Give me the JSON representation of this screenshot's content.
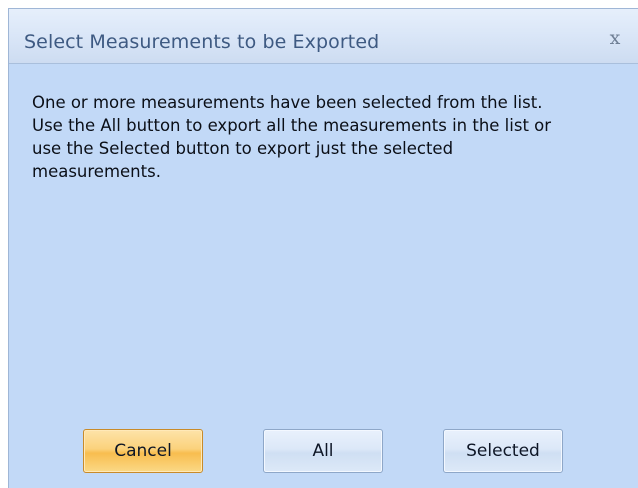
{
  "dialog": {
    "title": "Select Measurements to be Exported",
    "close_icon": "close-icon",
    "message_lines": [
      "One or more measurements have been selected from the list.",
      "Use the All button to export all the measurements in the list or",
      "use the Selected button to export just the selected",
      "measurements."
    ],
    "buttons": {
      "cancel": "Cancel",
      "all": "All",
      "selected": "Selected"
    }
  },
  "colors": {
    "dialog_background": "#c2d9f7",
    "title_text": "#3e5a82",
    "default_button": "#fbd27c"
  }
}
